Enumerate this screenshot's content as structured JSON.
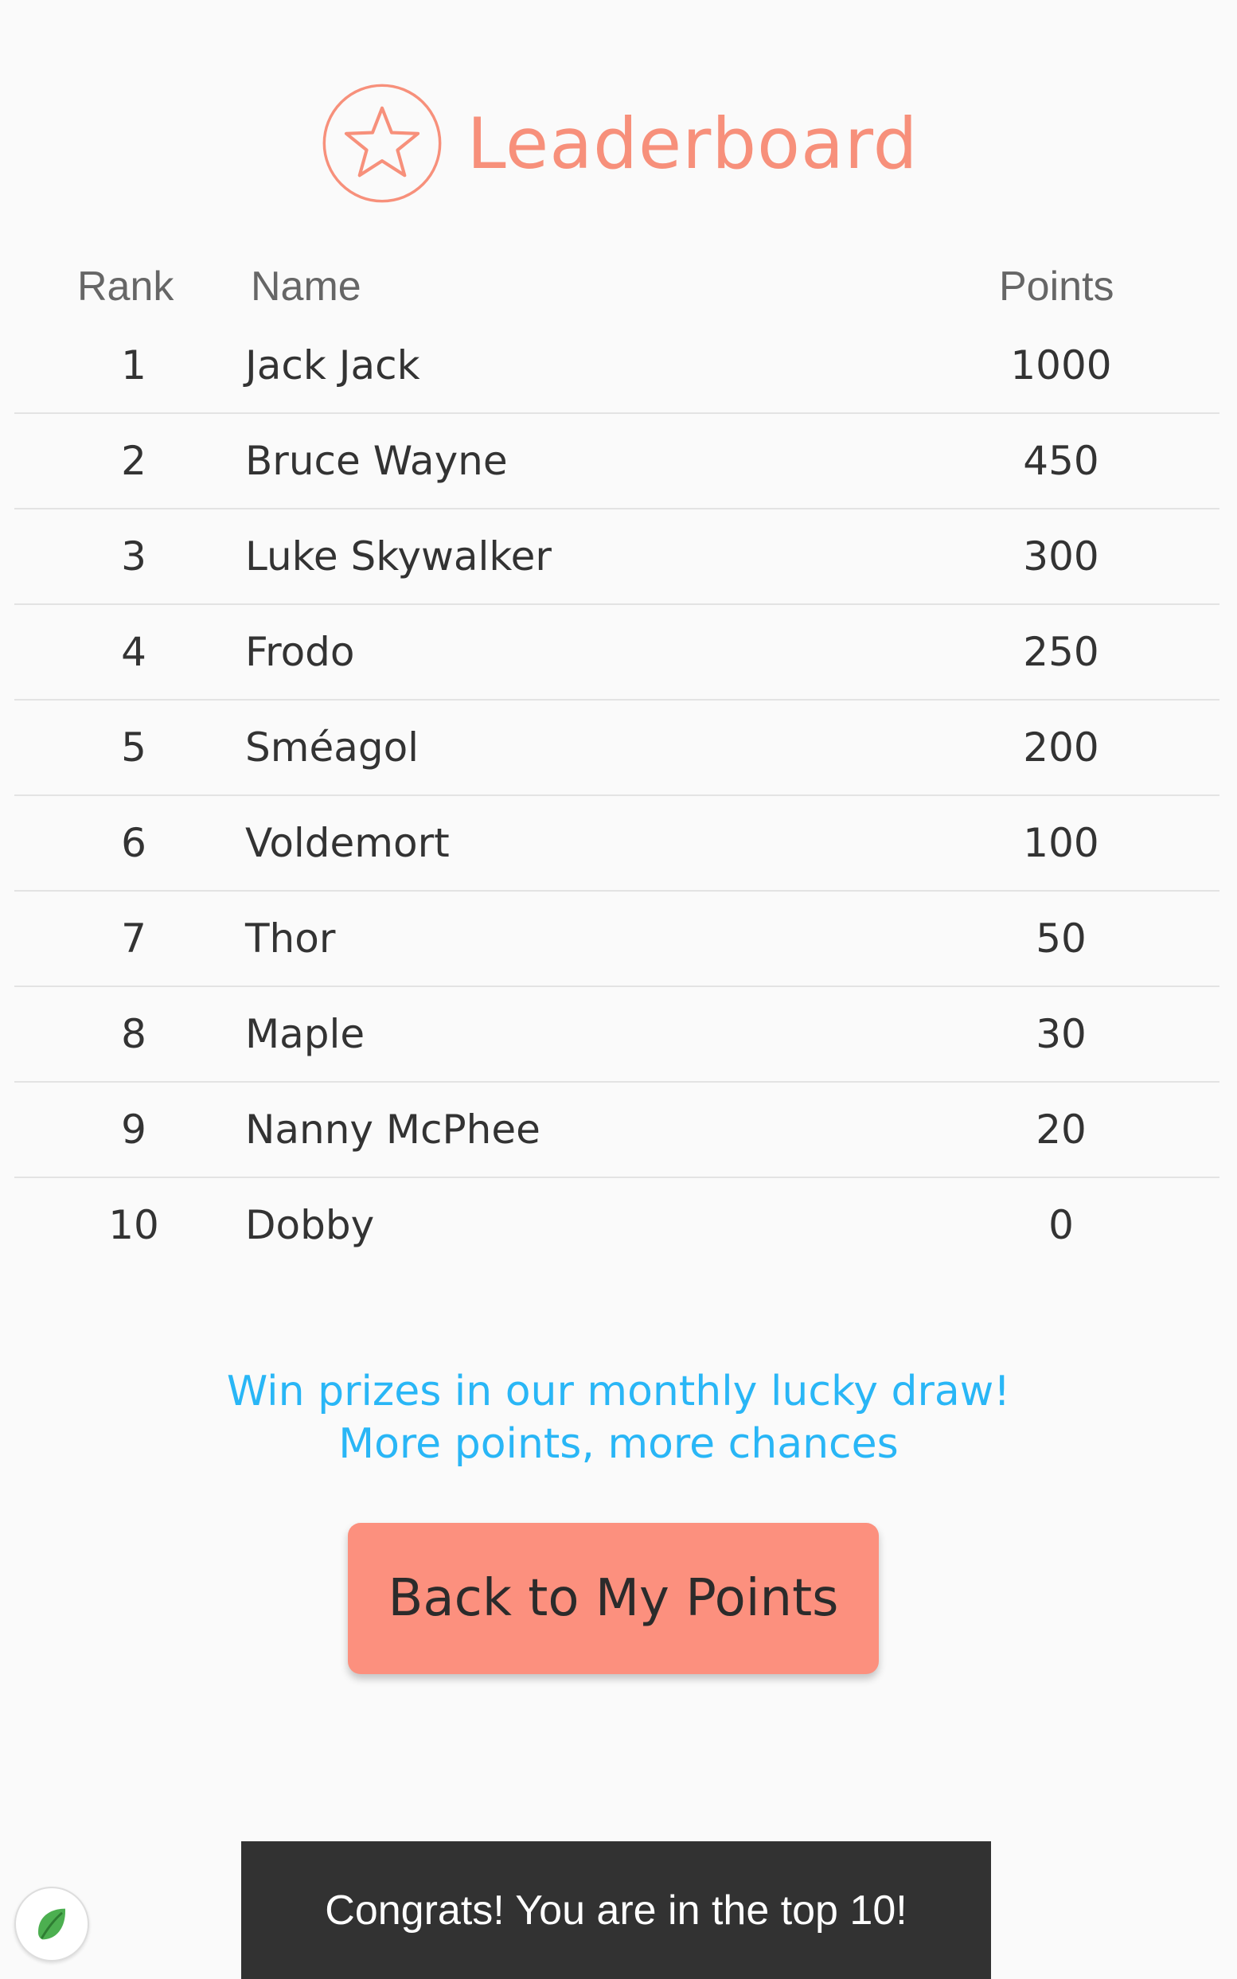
{
  "header": {
    "title": "Leaderboard",
    "icon": "star-circle-icon",
    "accent_color": "#f7907b"
  },
  "table": {
    "columns": {
      "rank": "Rank",
      "name": "Name",
      "points": "Points"
    },
    "rows": [
      {
        "rank": "1",
        "name": "Jack Jack",
        "points": "1000"
      },
      {
        "rank": "2",
        "name": "Bruce Wayne",
        "points": "450"
      },
      {
        "rank": "3",
        "name": "Luke Skywalker",
        "points": "300"
      },
      {
        "rank": "4",
        "name": "Frodo",
        "points": "250"
      },
      {
        "rank": "5",
        "name": "Sméagol",
        "points": "200"
      },
      {
        "rank": "6",
        "name": "Voldemort",
        "points": "100"
      },
      {
        "rank": "7",
        "name": "Thor",
        "points": "50"
      },
      {
        "rank": "8",
        "name": "Maple",
        "points": "30"
      },
      {
        "rank": "9",
        "name": "Nanny McPhee",
        "points": "20"
      },
      {
        "rank": "10",
        "name": "Dobby",
        "points": "0"
      }
    ]
  },
  "promo": {
    "line1": "Win prizes in our monthly lucky draw!",
    "line2": "More points, more chances",
    "color": "#29b6f6"
  },
  "actions": {
    "back_label": "Back to My Points",
    "button_color": "#fc907e"
  },
  "snackbar": {
    "message": "Congrats! You are in the top 10!"
  },
  "badge": {
    "icon": "leaf-icon",
    "color": "#4caf50"
  }
}
